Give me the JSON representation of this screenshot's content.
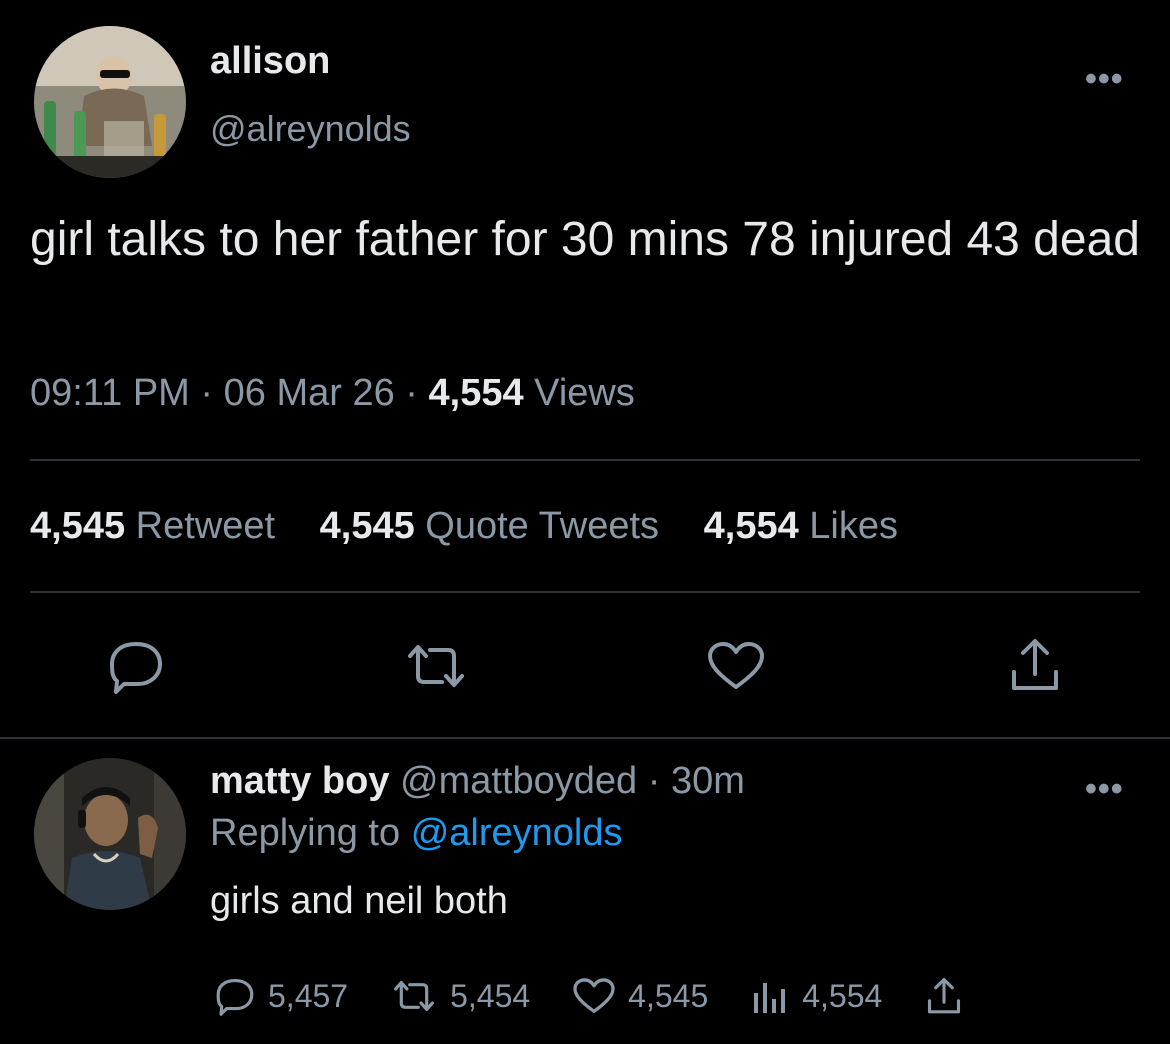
{
  "tweet": {
    "author_name": "allison",
    "author_handle": "@alreynolds",
    "text": "girl talks to her father for 30 mins 78 injured 43 dead",
    "time": "09:11 PM",
    "date": "06 Mar 26",
    "views_count": "4,554",
    "views_label": "Views",
    "retweet_count": "4,545",
    "retweet_label": "Retweet",
    "quote_count": "4,545",
    "quote_label": "Quote Tweets",
    "likes_count": "4,554",
    "likes_label": "Likes",
    "more_label": "•••"
  },
  "actions": {
    "icons": [
      "reply-icon",
      "retweet-icon",
      "like-icon",
      "share-icon"
    ]
  },
  "reply": {
    "author_name": "matty boy",
    "author_handle": "@mattboyded",
    "time": "30m",
    "replying_prefix": "Replying to",
    "replying_handle": "@alreynolds",
    "text": "girls and neil both",
    "reply_count": "5,457",
    "retweet_count": "5,454",
    "like_count": "4,545",
    "views_count": "4,554",
    "more_label": "•••"
  },
  "colors": {
    "background": "#000000",
    "primary_text": "#e7e9ea",
    "secondary_text": "#8b98a5",
    "link": "#1d9bf0",
    "divider": "#2f3336"
  }
}
